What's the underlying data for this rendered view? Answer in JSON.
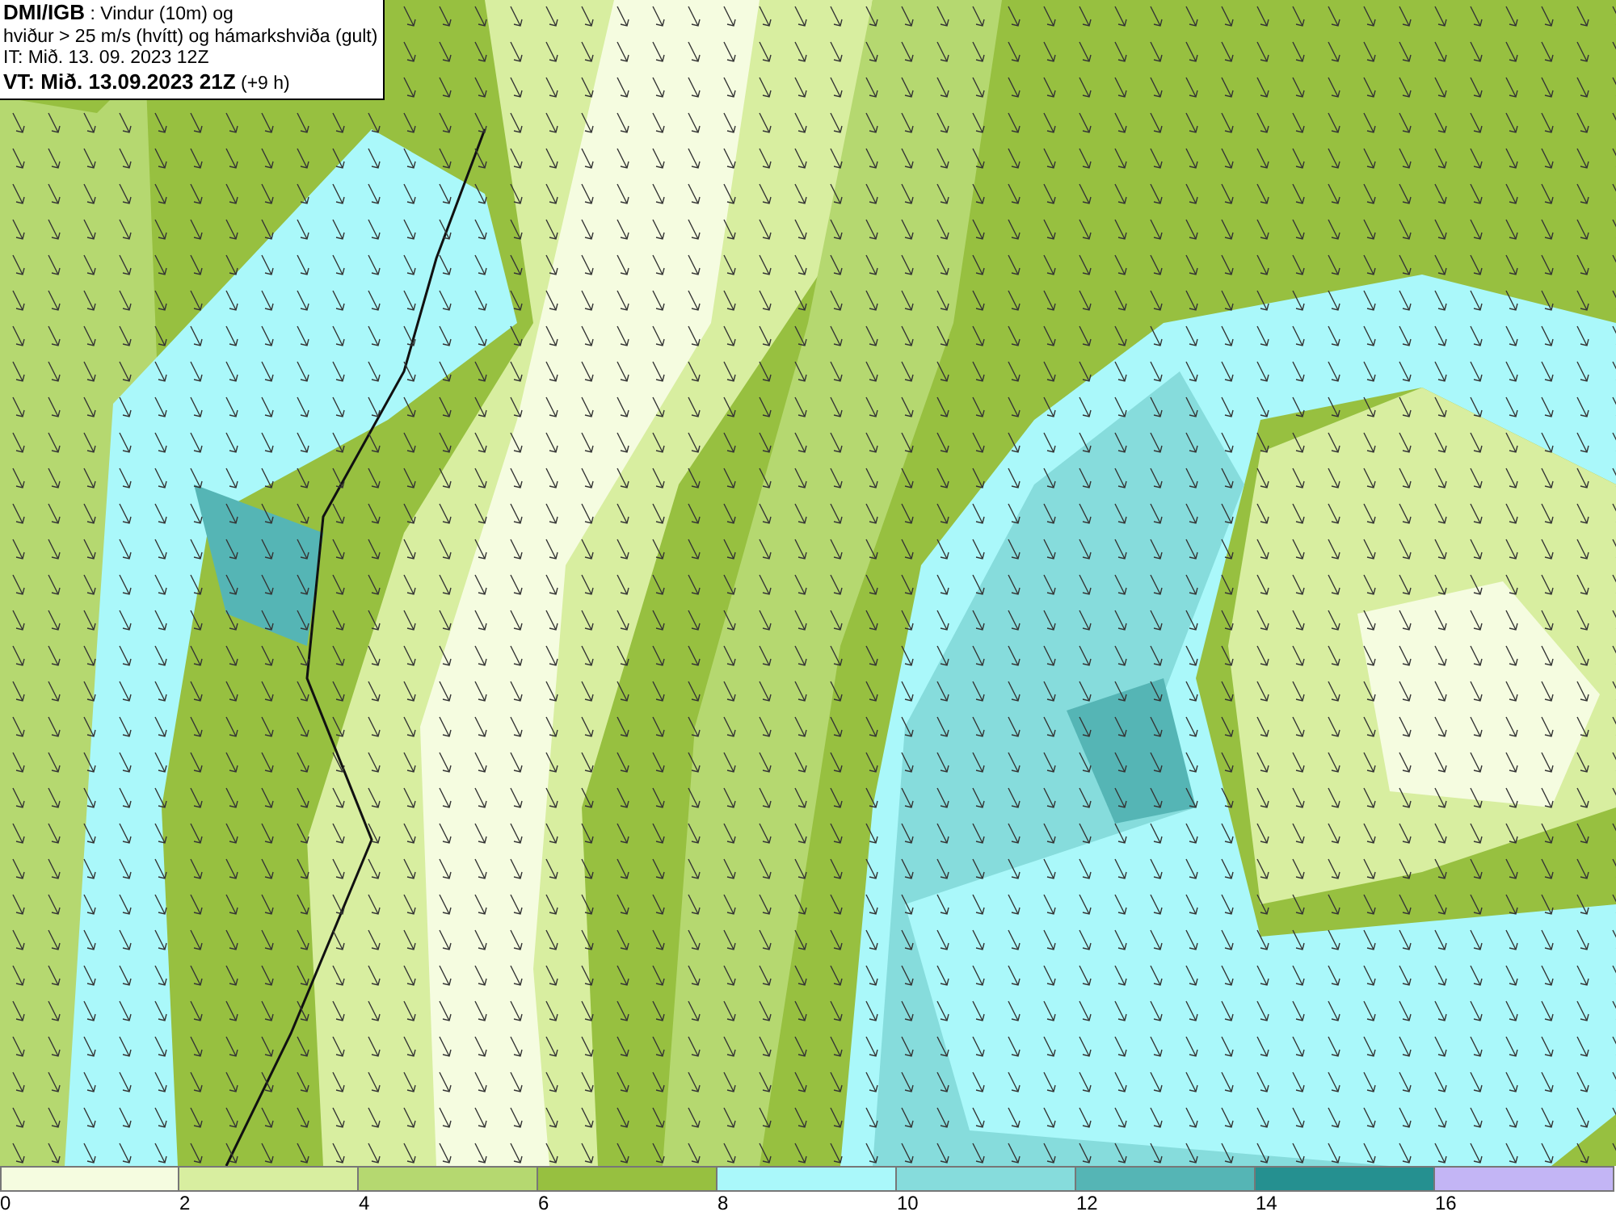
{
  "info_box": {
    "lines": [
      "**DMI/IGB** : Vindur (10m) og",
      "hviður > 25 m/s (hvítt) og hámarkshviða (gult)",
      "IT: Mið. 13. 09. 2023 12Z",
      "**VT: Mið. 13.09.2023 21Z** (+9 h)"
    ]
  },
  "legend": {
    "bins": [
      {
        "color": "#f5fce0"
      },
      {
        "color": "#d8eea0"
      },
      {
        "color": "#b5d870"
      },
      {
        "color": "#97c040"
      },
      {
        "color": "#aaf8fa"
      },
      {
        "color": "#86dcdc"
      },
      {
        "color": "#55b5b5"
      },
      {
        "color": "#259090"
      },
      {
        "color": "#c3b5f5"
      }
    ],
    "ticks": [
      "0",
      "2",
      "4",
      "6",
      "8",
      "10",
      "12",
      "14",
      "16"
    ]
  }
}
